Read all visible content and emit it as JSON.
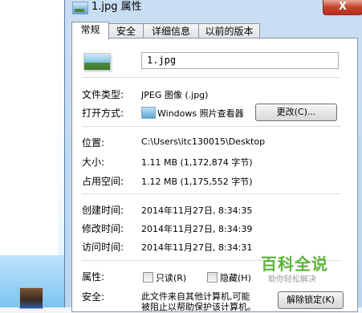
{
  "window": {
    "title": "1.jpg 属性",
    "close_glyph": "X"
  },
  "tabs": [
    {
      "label": "常规",
      "active": true
    },
    {
      "label": "安全",
      "active": false
    },
    {
      "label": "详细信息",
      "active": false
    },
    {
      "label": "以前的版本",
      "active": false
    }
  ],
  "general": {
    "filename": "1.jpg",
    "file_type_label": "文件类型:",
    "file_type_value": "JPEG 图像 (.jpg)",
    "open_with_label": "打开方式:",
    "open_with_value": "Windows 照片查看器",
    "change_button": "更改(C)...",
    "location_label": "位置:",
    "location_value": "C:\\Users\\itc130015\\Desktop",
    "size_label": "大小:",
    "size_value": "1.11 MB (1,172,874 字节)",
    "disk_size_label": "占用空间:",
    "disk_size_value": "1.12 MB (1,175,552 字节)",
    "created_label": "创建时间:",
    "created_value": "2014年11月27日, 8:34:35",
    "modified_label": "修改时间:",
    "modified_value": "2014年11月27日, 8:34:39",
    "accessed_label": "访问时间:",
    "accessed_value": "2014年11月27日, 8:34:31",
    "attributes_label": "属性:",
    "readonly_label": "只读(R)",
    "hidden_label": "隐藏(H)",
    "readonly_checked": false,
    "hidden_checked": false,
    "security_label": "安全:",
    "security_text_line1": "此文件来自其他计算机,可能",
    "security_text_line2": "被阻止以帮助保护该计算机。",
    "unblock_button": "解除锁定(K)"
  },
  "watermark": {
    "main": "百科全说",
    "sub": "助你轻松解决"
  }
}
